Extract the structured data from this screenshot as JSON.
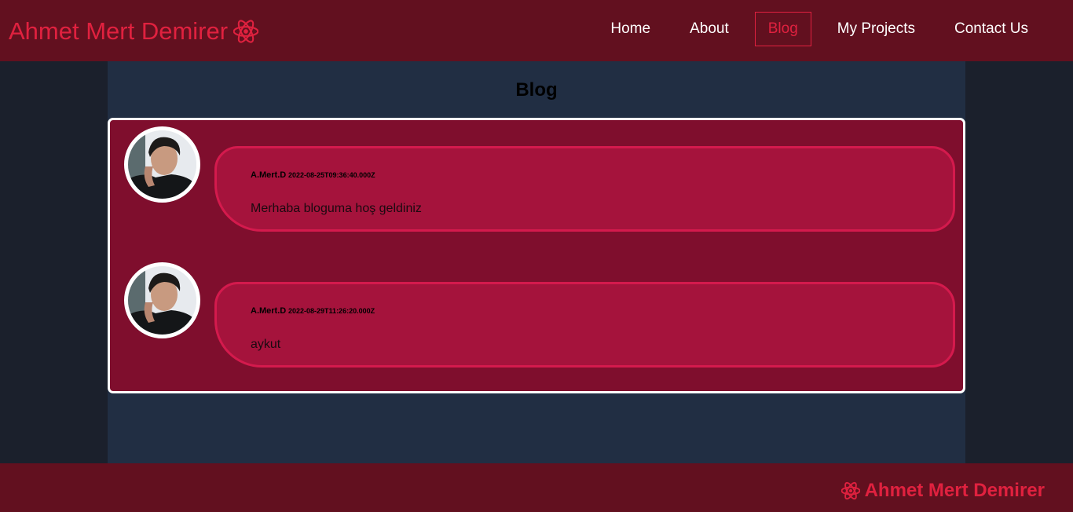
{
  "header": {
    "brand": "Ahmet Mert Demirer",
    "brand_icon": "react-atom-icon",
    "nav": [
      {
        "label": "Home",
        "active": false
      },
      {
        "label": "About",
        "active": false
      },
      {
        "label": "Blog",
        "active": true
      },
      {
        "label": "My Projects",
        "active": false
      },
      {
        "label": "Contact Us",
        "active": false
      }
    ]
  },
  "main": {
    "title": "Blog",
    "posts": [
      {
        "author": "A.Mert.D",
        "date": "2022-08-25T09:36:40.000Z",
        "content": "Merhaba bloguma hoş geldiniz"
      },
      {
        "author": "A.Mert.D",
        "date": "2022-08-29T11:26:20.000Z",
        "content": "aykut"
      }
    ]
  },
  "footer": {
    "brand": "Ahmet Mert Demirer",
    "brand_icon": "react-atom-icon"
  },
  "colors": {
    "header_bg": "#62101f",
    "accent": "#e0213f",
    "page_bg": "#1b202c",
    "main_bg": "#212e43",
    "posts_bg": "#7f0e2d",
    "bubble_bg": "#a5133c",
    "bubble_border": "#d41a4d"
  }
}
